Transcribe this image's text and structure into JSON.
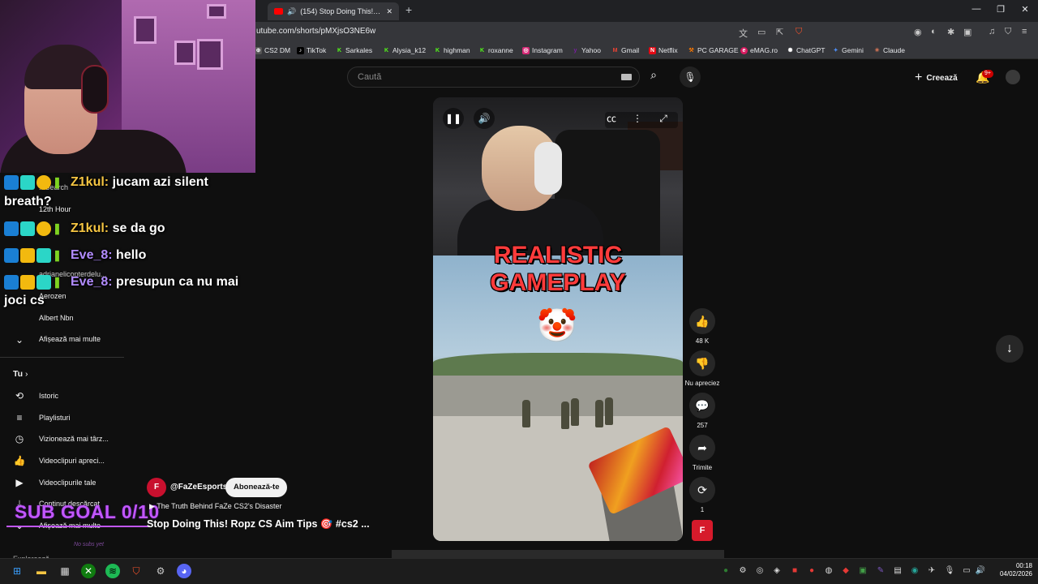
{
  "browser": {
    "tab_title": "(154) Stop Doing This! Ropz C",
    "url": "utube.com/shorts/pMXjsO3NE6w",
    "bookmarks": [
      "CS2 DM",
      "TikTok",
      "Sarkales",
      "Alysia_k12",
      "highman",
      "roxanne",
      "Instagram",
      "Yahoo",
      "Gmail",
      "Netflix",
      "PC GARAGE",
      "eMAG.ro",
      "ChatGPT",
      "Gemini",
      "Claude"
    ]
  },
  "header": {
    "search_placeholder": "Caută",
    "create_label": "Creează",
    "notif_count": "9+"
  },
  "chat": [
    {
      "user": "Z1kul:",
      "color": "#f5c542",
      "msg": "jucam azi silent",
      "cont": "breath?"
    },
    {
      "user": "Z1kul:",
      "color": "#f5c542",
      "msg": "se da go",
      "cont": ""
    },
    {
      "user": "Eve_8:",
      "color": "#b28cff",
      "msg": "hello",
      "cont": ""
    },
    {
      "user": "Eve_8:",
      "color": "#b28cff",
      "msg": "presupun ca nu mai",
      "cont": "joci cs"
    }
  ],
  "sidebar": {
    "subs_partial": [
      "...Search",
      "12th Hour",
      "...",
      "...",
      "adrianelicopterdelu...",
      "Aerozen",
      "Albert Nbn"
    ],
    "show_more": "Afișează mai multe",
    "you_label": "Tu",
    "you_items": [
      "Istoric",
      "Playlisturi",
      "Vizionează mai târz...",
      "Videoclipuri apreci...",
      "Videoclipurile tale",
      "Continut descărcat"
    ],
    "show_more_2": "Afișează mai multe",
    "explore": "Explorează"
  },
  "overlay": {
    "sub_goal": "SUB GOAL 0/10",
    "no_subs": "No subs yet"
  },
  "video": {
    "caption_line1": "REALISTIC",
    "caption_line2": "GAMEPLAY",
    "clown": "🤡",
    "channel": "@FaZeEsports",
    "subscribe_label": "Abonează-te",
    "related": "The Truth Behind FaZe CS2's Disaster",
    "title": "Stop Doing This! Ropz CS Aim Tips 🎯 #cs2 ..."
  },
  "actions": {
    "likes": "48 K",
    "dislike_label": "Nu apreciez",
    "comments": "257",
    "share_label": "Trimite",
    "remix_count": "1"
  },
  "taskbar": {
    "time": "00:18",
    "date": "04/02/2026"
  },
  "colors": {
    "youtube_red": "#ff0000",
    "sub_goal": "#c257ff",
    "faze_red": "#d61a2b"
  }
}
